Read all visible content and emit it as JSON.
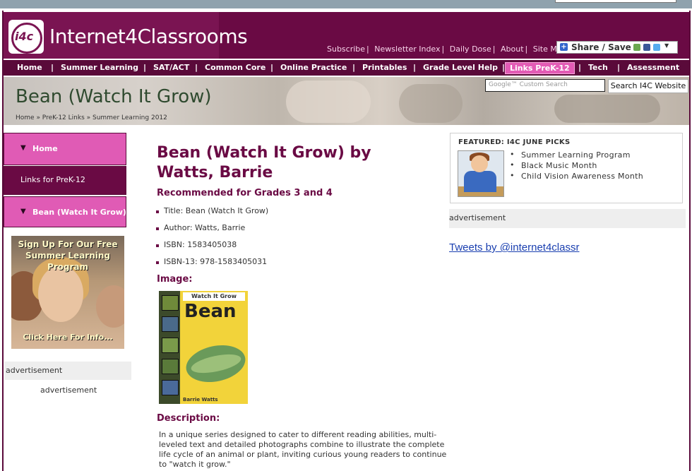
{
  "header": {
    "logo_badge": "i4c",
    "logo_text": "Internet4Classrooms",
    "top_links": [
      "Subscribe",
      "Newsletter Index",
      "Daily Dose",
      "About",
      "Site Map"
    ],
    "share_label": "Share / Save"
  },
  "nav": {
    "items": [
      "Home",
      "Summer Learning",
      "SAT/ACT",
      "Common Core",
      "Online Practice",
      "Printables",
      "Grade Level Help",
      "Links PreK-12",
      "Tech",
      "Assessment"
    ],
    "active": "Links PreK-12"
  },
  "banner": {
    "title": "Bean (Watch It Grow)",
    "breadcrumb": "Home  »  PreK-12 Links  »  Summer Learning 2012",
    "search_placeholder": "Google™ Custom Search",
    "search_button": "Search I4C Website"
  },
  "sidebar": {
    "items": [
      "Home",
      "Links for PreK-12",
      "Bean (Watch It Grow)"
    ],
    "promo_top": "Sign Up For Our Free Summer Learning Program",
    "promo_bottom": "Click Here For Info...",
    "ad1": "advertisement",
    "ad2": "advertisement"
  },
  "main": {
    "title": "Bean (Watch It Grow) by Watts, Barrie",
    "recommended": "Recommended for Grades 3 and 4",
    "meta": [
      "Title: Bean (Watch It Grow)",
      "Author: Watts, Barrie",
      "ISBN: 1583405038",
      "ISBN-13: 978-1583405031"
    ],
    "image_heading": "Image:",
    "book_banner": "Watch It Grow",
    "book_title": "Bean",
    "book_author": "Barrie Watts",
    "description_heading": "Description:",
    "description": "In a unique series designed to cater to different reading abilities, multi-leveled text and detailed photographs combine to illustrate the complete life cycle of an animal or plant, inviting curious young readers to continue to \"watch it grow.\""
  },
  "right": {
    "featured_heading": "FEATURED: I4C JUNE PICKS",
    "featured_items": [
      "Summer Learning Program",
      "Black Music Month",
      "Child Vision Awareness Month"
    ],
    "ad": "advertisement",
    "tweets_link": "Tweets by @internet4classr"
  },
  "colors": {
    "brand": "#6a0a44",
    "nav_active": "#e35bb5",
    "sidebar_pink": "#e05bb5",
    "link_blue": "#1a3fb0"
  }
}
